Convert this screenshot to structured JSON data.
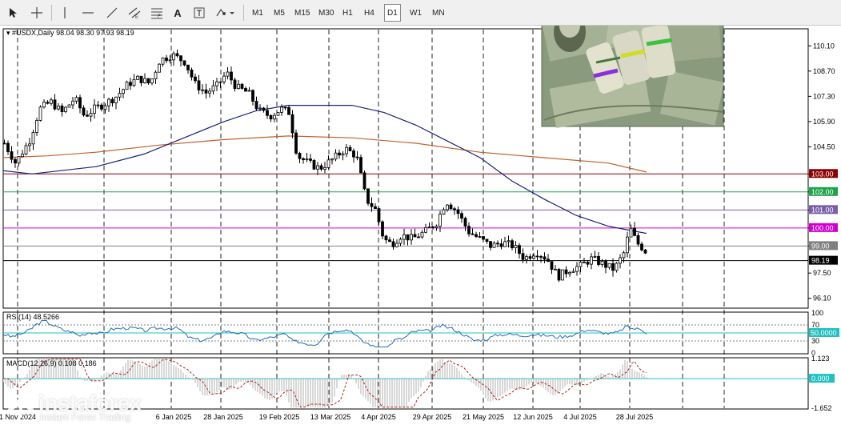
{
  "toolbar": {
    "tools": [
      "cursor-icon",
      "crosshair-icon",
      "vertical-line-icon",
      "horizontal-line-icon",
      "trend-line-icon",
      "channel-icon",
      "fibonacci-icon",
      "text-tool-icon",
      "text-label-icon",
      "shapes-dropdown-icon"
    ],
    "text_label": "A",
    "timeframes": [
      "M1",
      "M5",
      "M15",
      "M30",
      "H1",
      "H4",
      "D1",
      "W1",
      "MN"
    ],
    "active_timeframe": "D1"
  },
  "chart_data": [
    {
      "type": "candlestick",
      "symbol": "#USDX,Daily",
      "ohlc_text": "98.04 98.30 97.93 98.19",
      "ylim": [
        95.6,
        111.0
      ],
      "y_ticks": [
        "110.10",
        "108.70",
        "107.30",
        "105.90",
        "104.50",
        "103.00",
        "102.00",
        "101.00",
        "100.00",
        "99.00",
        "97.50",
        "96.10"
      ],
      "x_ticks": [
        "1 Nov 2024",
        "",
        "6 Jan 2025",
        "28 Jan 2025",
        "19 Feb 2025",
        "13 Mar 2025",
        "4 Apr 2025",
        "29 Apr 2025",
        "21 May 2025",
        "12 Jun 2025",
        "4 Jul 2025",
        "28 Jul 2025"
      ],
      "level_lines": [
        {
          "label": "103.00",
          "value": 103.0,
          "color": "#8b0000"
        },
        {
          "label": "102.00",
          "value": 102.0,
          "color": "#1fa34a"
        },
        {
          "label": "101.00",
          "value": 101.0,
          "color": "#7b5ea7"
        },
        {
          "label": "100.00",
          "value": 100.0,
          "color": "#d100d1"
        },
        {
          "label": "99.00",
          "value": 99.0,
          "color": "#808080"
        },
        {
          "label": "98.19",
          "value": 98.19,
          "color": "#000000"
        }
      ],
      "anchors": [
        [
          0,
          104.7
        ],
        [
          14,
          103.6
        ],
        [
          32,
          104.9
        ],
        [
          44,
          106.6
        ],
        [
          58,
          107.0
        ],
        [
          72,
          106.4
        ],
        [
          88,
          107.2
        ],
        [
          100,
          106.2
        ],
        [
          112,
          106.6
        ],
        [
          126,
          106.9
        ],
        [
          140,
          107.3
        ],
        [
          155,
          108.0
        ],
        [
          168,
          108.3
        ],
        [
          182,
          108.0
        ],
        [
          194,
          109.3
        ],
        [
          210,
          109.6
        ],
        [
          226,
          109.2
        ],
        [
          238,
          108.0
        ],
        [
          252,
          107.5
        ],
        [
          266,
          107.9
        ],
        [
          278,
          108.6
        ],
        [
          290,
          107.8
        ],
        [
          305,
          107.5
        ],
        [
          318,
          106.5
        ],
        [
          332,
          106.2
        ],
        [
          346,
          106.6
        ],
        [
          356,
          106.4
        ],
        [
          366,
          104.0
        ],
        [
          380,
          103.6
        ],
        [
          394,
          103.3
        ],
        [
          410,
          103.8
        ],
        [
          426,
          104.4
        ],
        [
          440,
          104.0
        ],
        [
          452,
          101.6
        ],
        [
          464,
          101.0
        ],
        [
          474,
          99.4
        ],
        [
          484,
          99.1
        ],
        [
          496,
          99.6
        ],
        [
          510,
          99.4
        ],
        [
          526,
          99.8
        ],
        [
          540,
          100.3
        ],
        [
          552,
          101.5
        ],
        [
          566,
          100.9
        ],
        [
          580,
          99.8
        ],
        [
          594,
          99.4
        ],
        [
          608,
          99.0
        ],
        [
          622,
          99.2
        ],
        [
          636,
          99.0
        ],
        [
          650,
          98.3
        ],
        [
          664,
          98.7
        ],
        [
          678,
          98.3
        ],
        [
          692,
          97.3
        ],
        [
          706,
          97.7
        ],
        [
          720,
          97.9
        ],
        [
          734,
          98.3
        ],
        [
          748,
          98.0
        ],
        [
          762,
          97.7
        ],
        [
          774,
          98.6
        ],
        [
          782,
          100.0
        ],
        [
          790,
          99.2
        ],
        [
          800,
          98.8
        ],
        [
          808,
          98.19
        ]
      ],
      "ma_blue": [
        [
          0,
          103.2
        ],
        [
          40,
          103.0
        ],
        [
          120,
          103.4
        ],
        [
          180,
          104.1
        ],
        [
          230,
          105.0
        ],
        [
          280,
          105.9
        ],
        [
          320,
          106.5
        ],
        [
          360,
          106.8
        ],
        [
          440,
          106.8
        ],
        [
          480,
          106.4
        ],
        [
          520,
          105.7
        ],
        [
          560,
          104.8
        ],
        [
          600,
          103.9
        ],
        [
          640,
          102.6
        ],
        [
          680,
          101.6
        ],
        [
          720,
          100.7
        ],
        [
          760,
          100.1
        ],
        [
          808,
          99.7
        ]
      ],
      "ma_orange": [
        [
          0,
          103.9
        ],
        [
          60,
          104.0
        ],
        [
          120,
          104.2
        ],
        [
          200,
          104.6
        ],
        [
          280,
          104.9
        ],
        [
          360,
          105.1
        ],
        [
          440,
          105.0
        ],
        [
          520,
          104.7
        ],
        [
          600,
          104.2
        ],
        [
          680,
          103.9
        ],
        [
          760,
          103.6
        ],
        [
          808,
          103.1
        ]
      ]
    },
    {
      "type": "line",
      "indicator": "RSI(14)",
      "value_text": "48.5266",
      "ylim": [
        0,
        100
      ],
      "y_ticks": [
        "100",
        "70",
        "30",
        "0"
      ],
      "levels": [
        70,
        30
      ],
      "current_label": "50.0000"
    },
    {
      "type": "histogram",
      "indicator": "MACD(12,26,9)",
      "values_text": "0.108 0.186",
      "ylim": [
        -1.652,
        1.123
      ],
      "y_ticks": [
        "1.123",
        "-1.652"
      ],
      "zero_label": "0.000"
    }
  ],
  "colors": {
    "bull": "#000000",
    "bear": "#000000",
    "ma_blue": "#1a237e",
    "ma_orange": "#c0622b",
    "rsi_line": "#1f6fb5",
    "rsi_mid": "#20c0c0",
    "macd_hist": "#b0b0b0",
    "macd_signal": "#b22222"
  },
  "watermark": {
    "brand": "instaforex",
    "tagline": "Instant Forex Trading"
  },
  "inset_image": {
    "name": "us-dollar-bills-photo"
  }
}
